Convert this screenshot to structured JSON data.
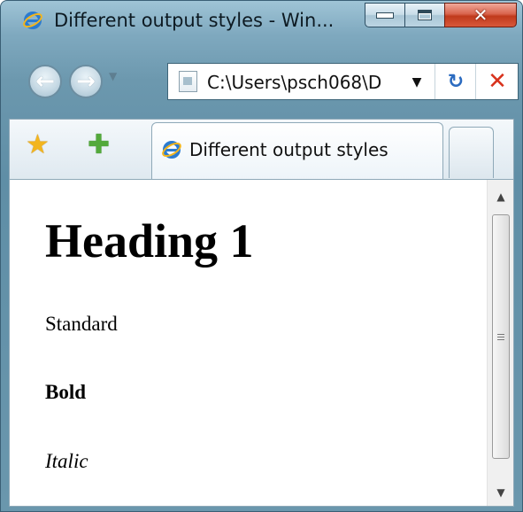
{
  "window": {
    "title": "Different output styles - Win..."
  },
  "caption_buttons": {
    "minimize": "minimize-icon",
    "maximize": "maximize-icon",
    "close": "✕"
  },
  "nav": {
    "back_icon": "←",
    "forward_icon": "→",
    "dropdown_icon": "▼"
  },
  "address": {
    "url": "C:\\Users\\psch068\\D",
    "dropdown_icon": "▼",
    "refresh_icon": "↻",
    "stop_icon": "✕"
  },
  "tabs": {
    "favorites_icon": "★",
    "add_favorites_icon": "✚",
    "active_tab_title": "Different output styles"
  },
  "document": {
    "heading": "Heading 1",
    "standard": "Standard",
    "bold": "Bold",
    "italic": "Italic"
  },
  "scrollbar": {
    "up": "▲",
    "down": "▼"
  }
}
